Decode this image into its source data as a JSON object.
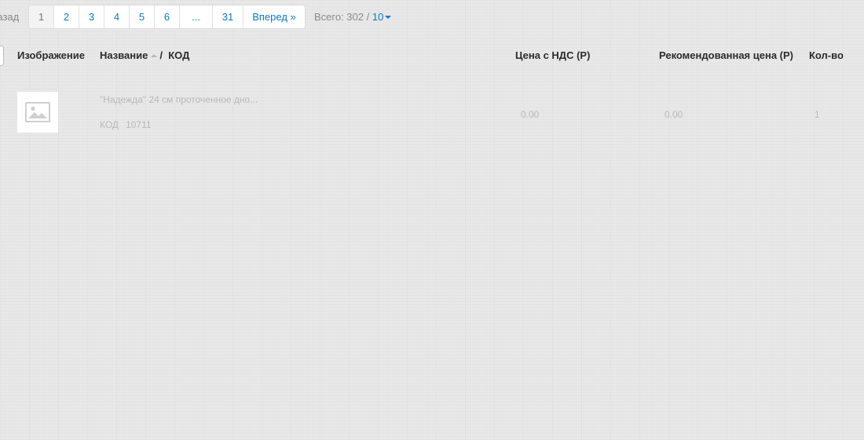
{
  "pagination": {
    "prev_label": "Назад",
    "pages": [
      "1",
      "2",
      "3",
      "4",
      "5",
      "6",
      "...",
      "31"
    ],
    "active_page": "1",
    "next_label": "Вперед »",
    "total_label": "Всего: 302 /",
    "per_page": "10"
  },
  "table": {
    "headers": {
      "image": "Изображение",
      "name": "Название",
      "separator": "/",
      "code": "КОД",
      "price": "Цена с НДС (Р)",
      "recommended": "Рекомендованная цена (Р)",
      "quantity": "Кол-во"
    },
    "rows": [
      {
        "image_icon": "image-placeholder-icon",
        "name": "\"Надежда\" 24 см проточенное дно...",
        "code_label": "КОД",
        "code": "10711",
        "price": "0.00",
        "recommended": "0.00",
        "quantity": "1"
      }
    ]
  },
  "colors": {
    "link": "#0b78c8",
    "muted_text": "#b9b9b9",
    "background": "#e7e7e7"
  }
}
